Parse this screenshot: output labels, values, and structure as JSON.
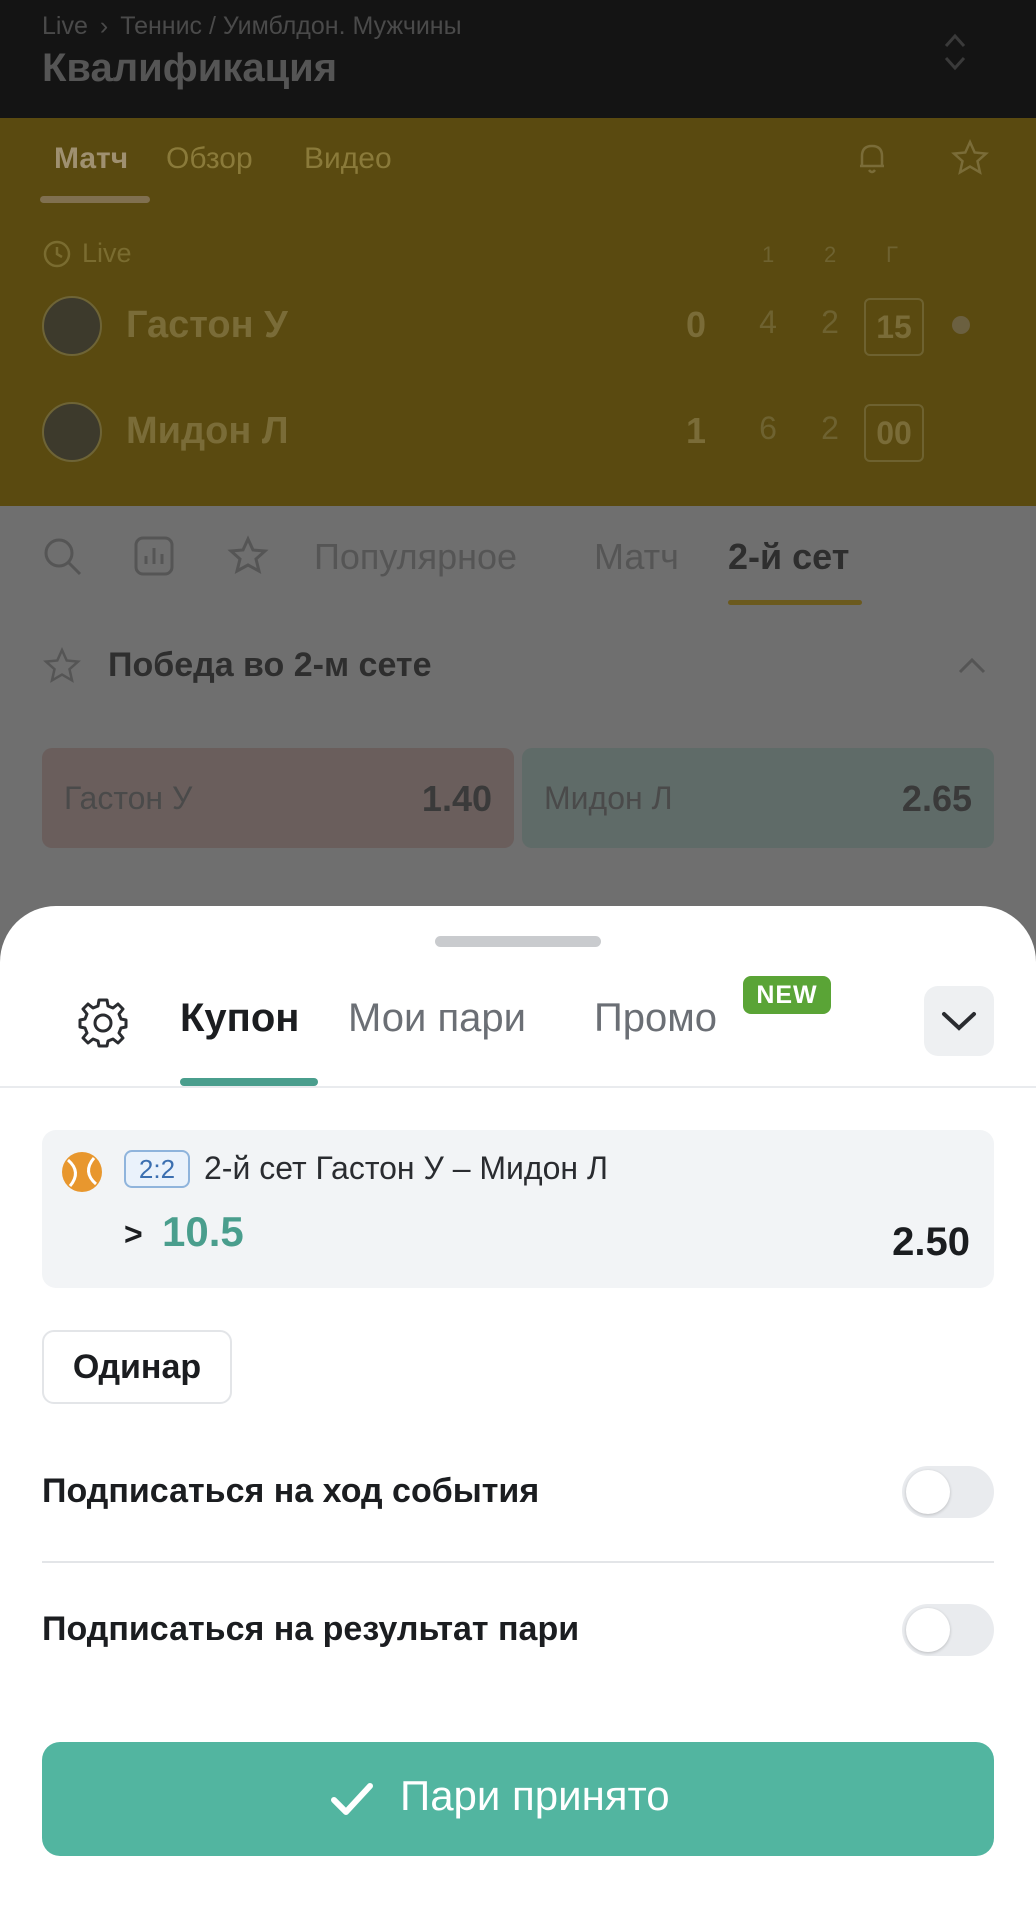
{
  "header": {
    "breadcrumb": [
      "Live",
      "Теннис / Уимблдон. Мужчины"
    ],
    "title": "Квалификация"
  },
  "match_tabs": [
    "Матч",
    "Обзор",
    "Видео"
  ],
  "live_label": "Live",
  "set_headers": [
    "1",
    "2",
    "Г"
  ],
  "players": [
    {
      "name": "Гастон У",
      "sets": "0",
      "s1": "4",
      "s2": "2",
      "game": "15"
    },
    {
      "name": "Мидон Л",
      "sets": "1",
      "s1": "6",
      "s2": "2",
      "game": "00"
    }
  ],
  "market_tabs": [
    "Популярное",
    "Матч",
    "2-й сет"
  ],
  "market": {
    "title": "Победа во 2-м сете",
    "odds": [
      {
        "label": "Гастон У",
        "value": "1.40"
      },
      {
        "label": "Мидон Л",
        "value": "2.65"
      }
    ]
  },
  "sheet": {
    "tabs": [
      "Купон",
      "Мои пари",
      "Промо"
    ],
    "new_badge": "NEW",
    "bet": {
      "score": "2:2",
      "event": "2-й сет Гастон У – Мидон Л",
      "selection_prefix": ">",
      "selection_value": "10.5",
      "odd": "2.50"
    },
    "bet_type": "Одинар",
    "subscriptions": [
      {
        "label": "Подписаться на ход события",
        "on": false
      },
      {
        "label": "Подписаться на результат пари",
        "on": false
      }
    ],
    "accept_label": "Пари принято"
  },
  "colors": {
    "accent": "#52b5a0",
    "selection": "#4a9e8d",
    "new_badge": "#5aa436",
    "overlay_header": "#141414",
    "overlay_match": "#5a4a10"
  }
}
